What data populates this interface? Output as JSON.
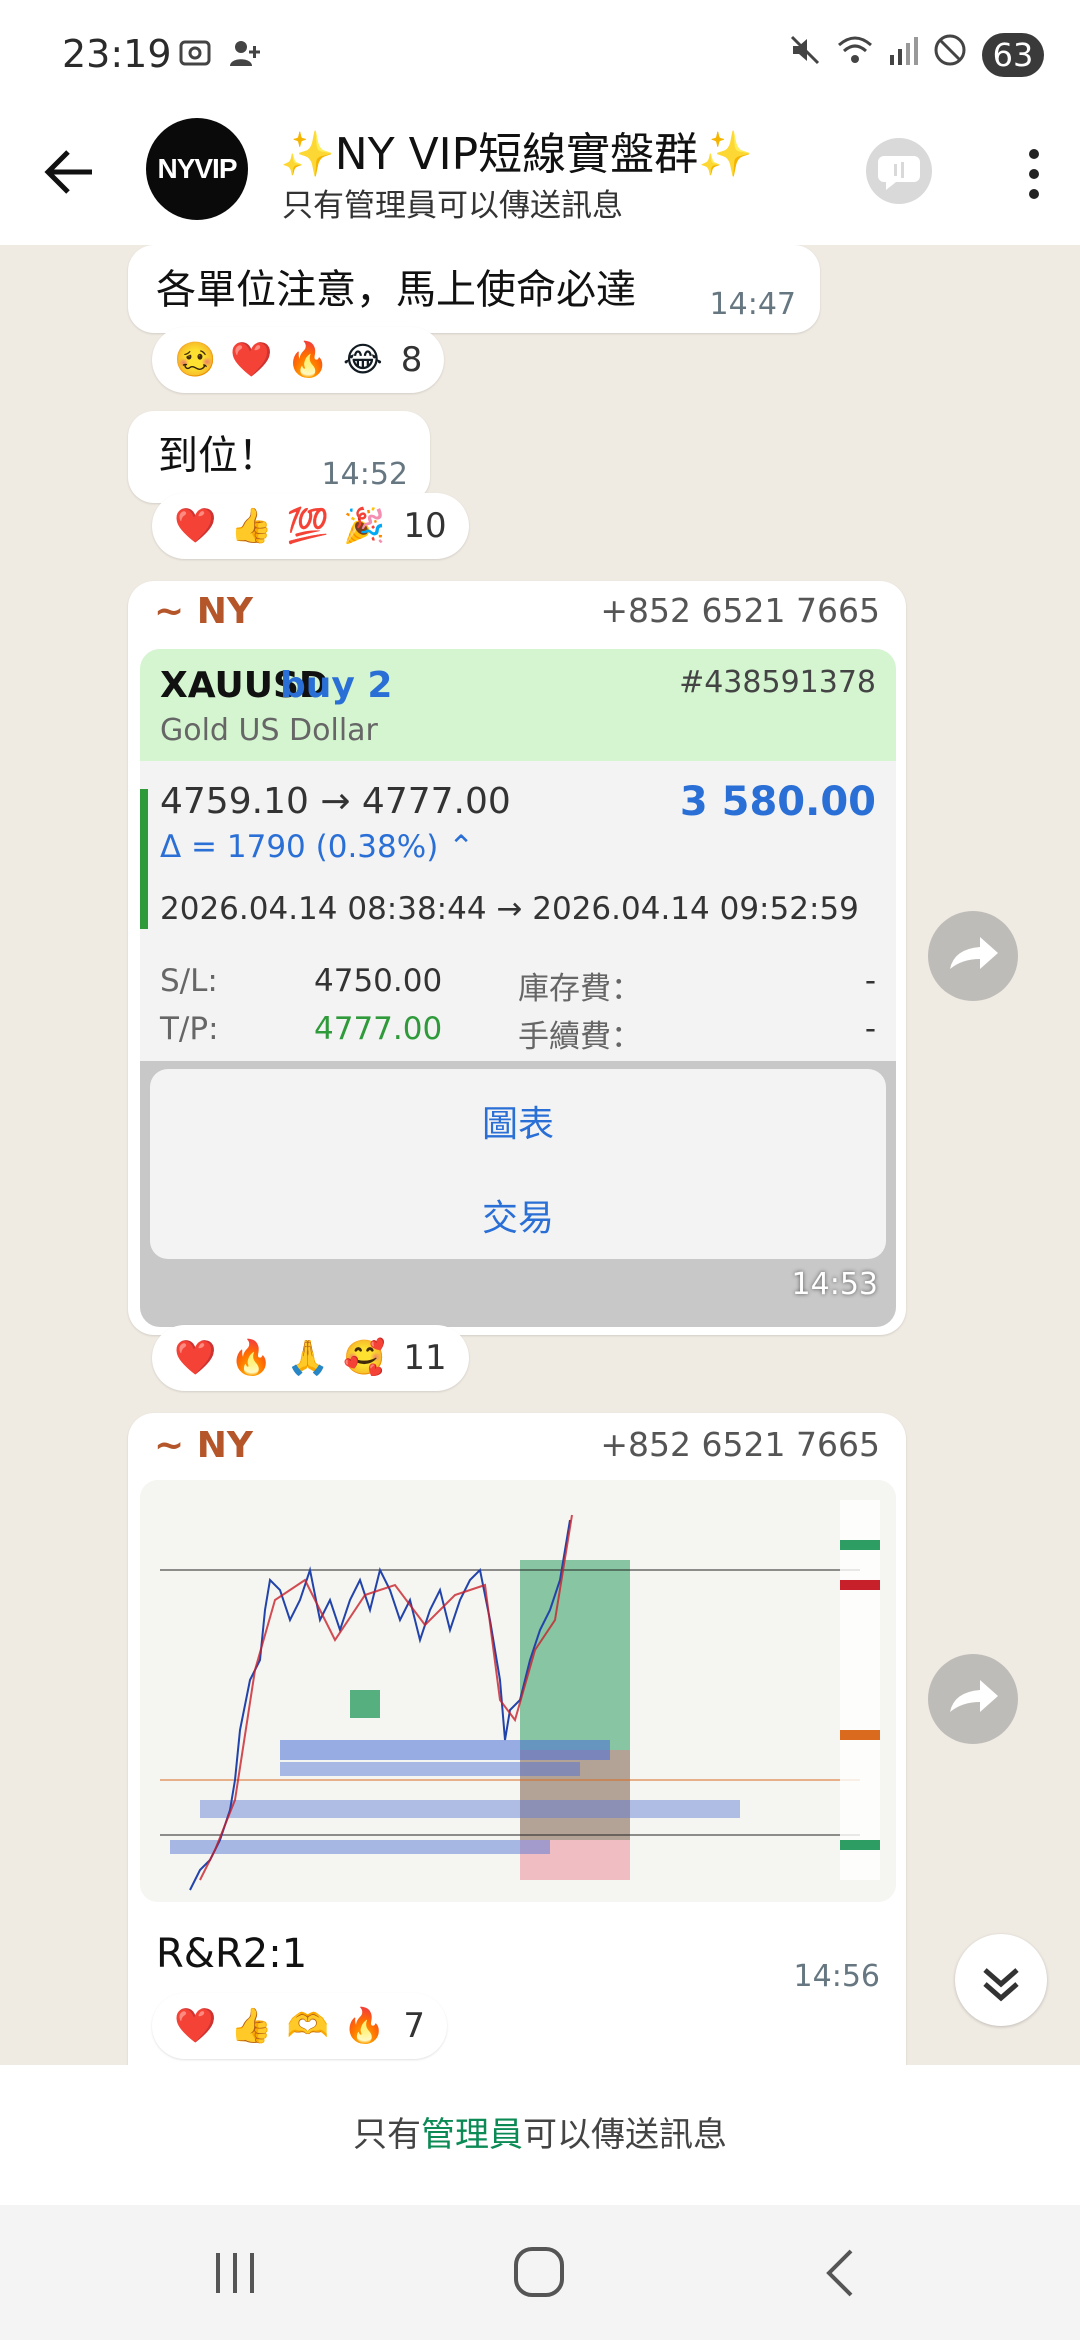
{
  "status_bar": {
    "time": "23:19",
    "battery": "63",
    "icons": [
      "screenshot-icon",
      "person-add-icon",
      "mute-icon",
      "wifi-icon",
      "signal-icon",
      "do-not-disturb-icon"
    ]
  },
  "header": {
    "avatar_text": "NYVIP",
    "title": "✨NY VIP短線實盤群✨",
    "subtitle": "只有管理員可以傳送訊息"
  },
  "messages": [
    {
      "text": "各單位注意，馬上使命必達",
      "time": "14:47",
      "reactions": [
        "🥴",
        "❤️",
        "🔥",
        "😂"
      ],
      "reaction_count": "8"
    },
    {
      "text": "到位！",
      "time": "14:52",
      "reactions": [
        "❤️",
        "👍",
        "💯",
        "🎉"
      ],
      "reaction_count": "10"
    },
    {
      "sender": "~ NY",
      "phone": "+852 6521 7665",
      "time": "14:53",
      "trade": {
        "symbol": "XAUUSD",
        "side": "buy 2",
        "ticket": "#438591378",
        "description": "Gold US Dollar",
        "prices": "4759.10 → 4777.00",
        "profit": "3 580.00",
        "delta": "Δ = 1790 (0.38%) ⌃",
        "dates": "2026.04.14 08:38:44 → 2026.04.14 09:52:59",
        "sl_label": "S/L:",
        "sl_value": "4750.00",
        "tp_label": "T/P:",
        "tp_value": "4777.00",
        "swap_label": "庫存費：",
        "swap_value": "-",
        "fee_label": "手續費：",
        "fee_value": "-"
      },
      "context_menu": [
        "圖表",
        "交易"
      ],
      "reactions": [
        "❤️",
        "🔥",
        "🙏",
        "🥰"
      ],
      "reaction_count": "11"
    },
    {
      "sender": "~ NY",
      "phone": "+852 6521 7665",
      "text": "R&R2:1",
      "time": "14:56",
      "reactions": [
        "❤️",
        "👍",
        "🫶",
        "🔥"
      ],
      "reaction_count": "7"
    }
  ],
  "footer": {
    "prefix": "只有",
    "admin": "管理員",
    "suffix": "可以傳送訊息"
  },
  "colors": {
    "chat_background": "#efeae2",
    "sender_name": "#b5562a",
    "admin_link": "#0c8a55",
    "trade_blue": "#2a6fd6",
    "trade_green": "#2e9a3a"
  }
}
